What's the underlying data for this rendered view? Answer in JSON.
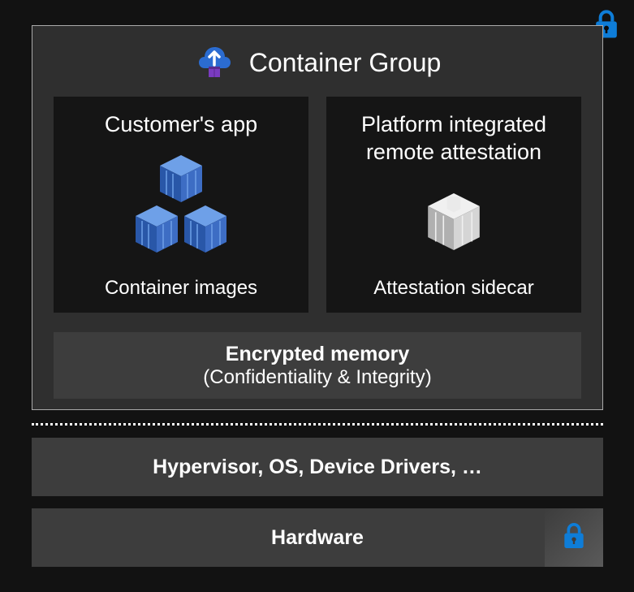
{
  "diagram": {
    "containerGroup": {
      "title": "Container Group",
      "boxes": {
        "customerApp": {
          "title": "Customer's app",
          "caption": "Container images"
        },
        "attestation": {
          "title": "Platform integrated\nremote attestation",
          "caption": "Attestation sidecar"
        }
      },
      "encryptedMemory": {
        "title": "Encrypted memory",
        "subtitle": "(Confidentiality & Integrity)"
      }
    },
    "layers": {
      "hypervisor": "Hypervisor, OS, Device Drivers, …",
      "hardware": "Hardware"
    }
  }
}
